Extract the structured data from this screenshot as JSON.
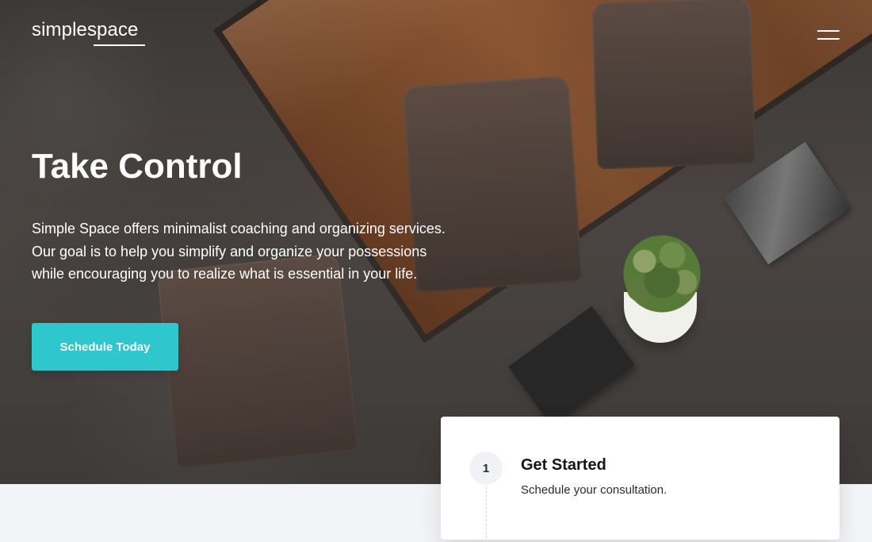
{
  "brand": {
    "logo": "simplespace"
  },
  "nav": {
    "menu_icon": "hamburger-menu-icon"
  },
  "hero": {
    "title": "Take Control",
    "description": "Simple Space offers minimalist coaching and organizing services. Our goal is to help you simplify and organize your possessions while encouraging you to realize what is essential in your life.",
    "cta_label": "Schedule Today"
  },
  "step": {
    "number": "1",
    "title": "Get Started",
    "description": "Schedule your consultation."
  },
  "colors": {
    "accent": "#2ec7cd",
    "text_light": "#ffffff",
    "page_background": "#f3f4f7",
    "card_background": "#ffffff"
  }
}
